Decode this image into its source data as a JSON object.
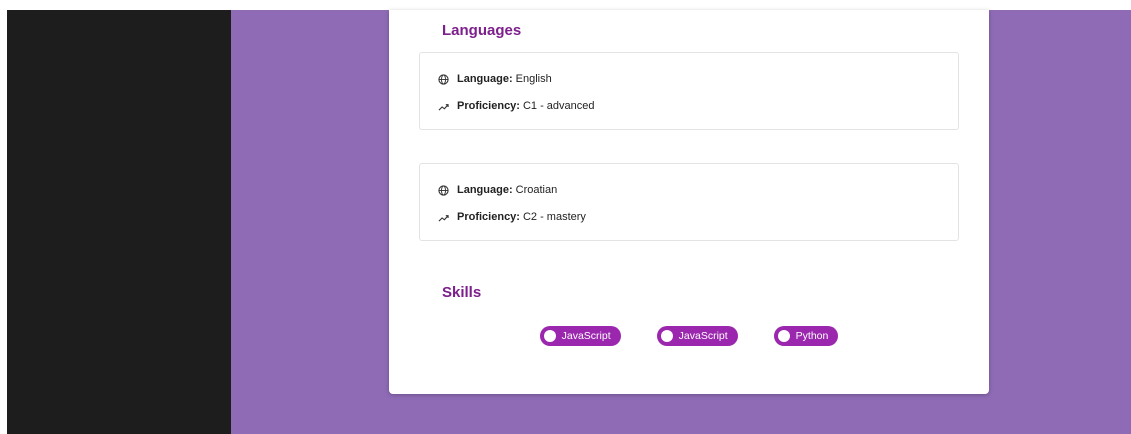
{
  "languages": {
    "title": "Languages",
    "language_label": "Language:",
    "proficiency_label": "Proficiency:",
    "entries": [
      {
        "language": "English",
        "proficiency": "C1 - advanced"
      },
      {
        "language": "Croatian",
        "proficiency": "C2 - mastery"
      }
    ],
    "icons": {
      "language": "globe-icon",
      "proficiency": "trending-up-icon"
    }
  },
  "skills": {
    "title": "Skills",
    "items": [
      "JavaScript",
      "JavaScript",
      "Python"
    ]
  },
  "colors": {
    "accent": "#9b27af",
    "title": "#7d1f8c",
    "background": "#8f6bb6",
    "sidebar": "#1d1d1d",
    "card": "#ffffff"
  }
}
